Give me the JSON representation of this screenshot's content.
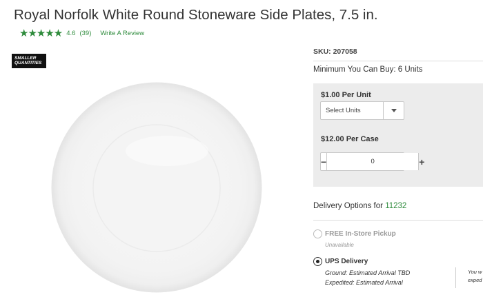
{
  "product": {
    "title": "Royal Norfolk White Round Stoneware Side Plates, 7.5 in.",
    "rating": {
      "stars": "★★★★★",
      "value": "4.6",
      "count": "(39)",
      "value_numeric": 4.6
    },
    "write_review": "Write A Review",
    "badge": {
      "line1": "SMALLER",
      "line2": "QUANTITIES"
    }
  },
  "details": {
    "sku": "SKU: 207058",
    "min_buy": "Minimum You Can Buy: 6 Units",
    "unit_price": "$1.00 Per Unit",
    "select_units": "Select Units",
    "case_price": "$12.00 Per Case",
    "quantity": "0",
    "minus": "−",
    "plus": "+"
  },
  "delivery": {
    "label": "Delivery Options for ",
    "zip": "11232",
    "options": [
      {
        "label": "FREE In-Store Pickup",
        "sub": "Unavailable",
        "selected": false
      },
      {
        "label": "UPS Delivery",
        "sub1": "Ground: Estimated Arrival TBD",
        "sub2": "Expedited: Estimated Arrival",
        "selected": true
      }
    ],
    "side_note": {
      "line1": "You w",
      "line2": "exped"
    }
  },
  "colors": {
    "accent": "#2e8b3c",
    "panel": "#ececec"
  }
}
